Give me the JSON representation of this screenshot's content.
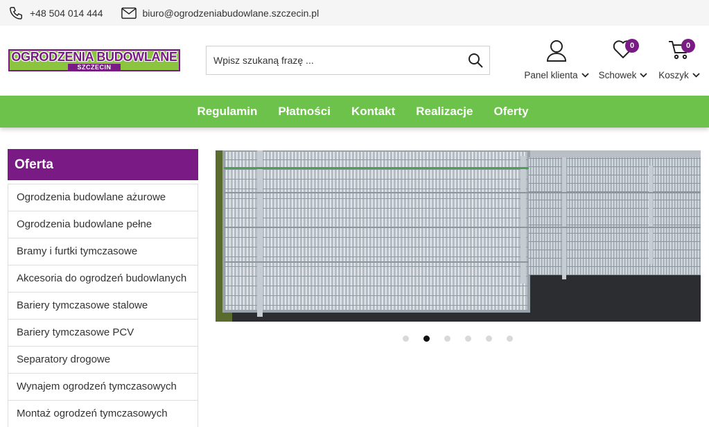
{
  "topbar": {
    "phone": "+48 504 014 444",
    "email": "biuro@ogrodzeniabudowlane.szczecin.pl",
    "phone_icon": "phone-icon",
    "email_icon": "envelope-icon"
  },
  "logo": {
    "title": "OGRODZENIA BUDOWLANE",
    "subtitle": "SZCZECIN"
  },
  "search": {
    "placeholder": "Wpisz szukaną frazę ...",
    "value": "",
    "icon": "search-icon"
  },
  "header_actions": [
    {
      "label": "Panel klienta",
      "icon": "user-icon"
    },
    {
      "label": "Schowek",
      "icon": "heart-icon",
      "badge": "0"
    },
    {
      "label": "Koszyk",
      "icon": "cart-icon",
      "badge": "0"
    }
  ],
  "nav": [
    "Regulamin",
    "Płatności",
    "Kontakt",
    "Realizacje",
    "Oferty"
  ],
  "sidebar": {
    "title": "Oferta",
    "items": [
      "Ogrodzenia budowlane ażurowe",
      "Ogrodzenia budowlane pełne",
      "Bramy i furtki tymczasowe",
      "Akcesoria do ogrodzeń budowlanych",
      "Bariery tymczasowe stalowe",
      "Bariery tymczasowe PCV",
      "Separatory drogowe",
      "Wynajem ogrodzeń tymczasowych",
      "Montaż ogrodzeń tymczasowych"
    ]
  },
  "slider": {
    "slides_count": 6,
    "active_index": 1
  },
  "colors": {
    "brand_purple": "#7a1a85",
    "nav_green": "#6cc24a",
    "logo_green": "#8bc53f"
  }
}
